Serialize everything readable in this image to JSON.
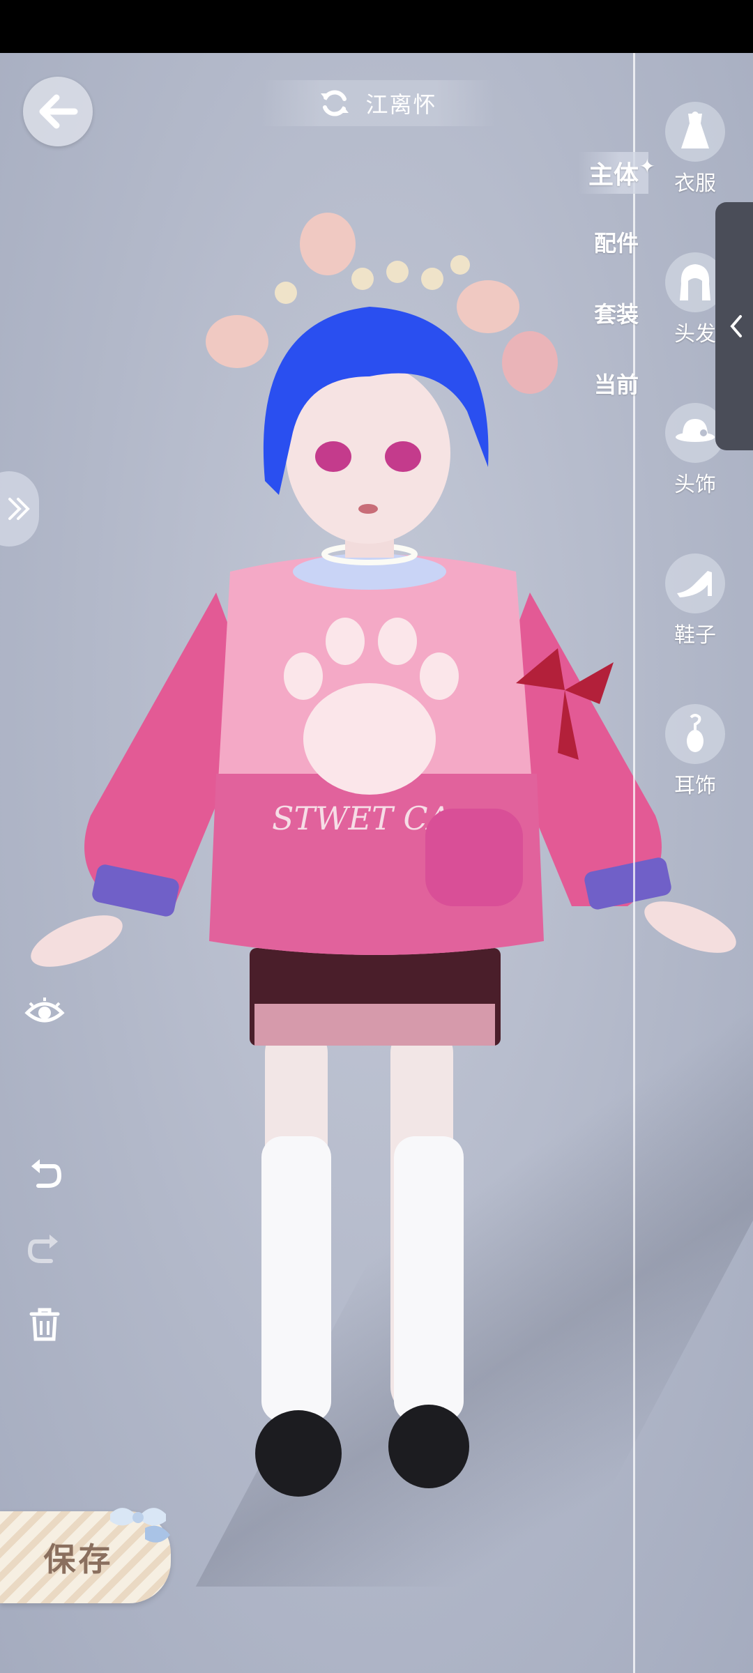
{
  "header": {
    "title": "江离怀"
  },
  "subtabs": [
    {
      "label": "主体",
      "active": true
    },
    {
      "label": "配件",
      "active": false
    },
    {
      "label": "套装",
      "active": false
    },
    {
      "label": "当前",
      "active": false
    }
  ],
  "categories": [
    {
      "label": "衣服",
      "icon": "dress-icon"
    },
    {
      "label": "头发",
      "icon": "hair-icon"
    },
    {
      "label": "头饰",
      "icon": "hat-icon"
    },
    {
      "label": "鞋子",
      "icon": "high-heel-icon"
    },
    {
      "label": "耳饰",
      "icon": "earring-icon"
    }
  ],
  "tools": [
    "eye-icon",
    "undo-icon",
    "redo-icon",
    "trash-icon"
  ],
  "save": {
    "label": "保存"
  },
  "character": {
    "sweater_text": "STWET CA"
  },
  "colors": {
    "accent_pink": "#e0609a",
    "hair_blue": "#2a4ff0",
    "status_bar": "#000000"
  }
}
